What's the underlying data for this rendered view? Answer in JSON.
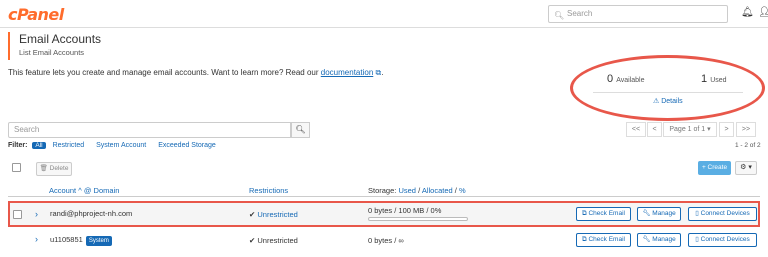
{
  "topbar": {
    "logo": "cPanel",
    "search_placeholder": "Search",
    "search_icon": "search-icon",
    "bell_icon": "bell-icon",
    "user_icon": "user-icon"
  },
  "page": {
    "title": "Email Accounts",
    "subtitle": "List Email Accounts",
    "description": "This feature lets you create and manage email accounts. Want to learn more? Read our",
    "doc_link": "documentation",
    "doc_suffix": "."
  },
  "stats": {
    "available_value": "0",
    "available_label": "Available",
    "used_value": "1",
    "used_label": "Used",
    "details_label": "Details"
  },
  "search": {
    "placeholder": "Search"
  },
  "pager": {
    "first": "<<",
    "prev": "<",
    "page_label": "Page 1 of 1",
    "next": ">",
    "last": ">>"
  },
  "filter": {
    "label": "Filter:",
    "all": "All",
    "restricted": "Restricted",
    "system": "System Account",
    "exceeded": "Exceeded Storage"
  },
  "count_label": "1 - 2 of 2",
  "toolbar": {
    "delete_label": "Delete",
    "create_label": "Create",
    "gear_label": "⚙ ▾"
  },
  "headers": {
    "account": "Account",
    "sort_icon": "^",
    "at_domain": "@ Domain",
    "restrictions": "Restrictions",
    "storage": "Storage:",
    "used": "Used",
    "slash1": "/",
    "allocated": "Allocated",
    "slash2": "/",
    "percent": "%"
  },
  "rows": [
    {
      "account": "randi@phproject-nh.com",
      "badge": "",
      "restriction": "Unrestricted",
      "storage": "0 bytes / 100 MB / 0%",
      "storage_fraction": 0,
      "check_email": "Check Email",
      "manage": "Manage",
      "connect": "Connect Devices"
    },
    {
      "account": "u1105851",
      "badge": "System",
      "restriction": "Unrestricted",
      "storage": "0 bytes / ∞",
      "check_email": "Check Email",
      "manage": "Manage",
      "connect": "Connect Devices"
    }
  ],
  "colors": {
    "accent": "#ff6c2c",
    "link": "#1569b5",
    "highlight": "#e8574a",
    "create": "#5aaee3"
  }
}
